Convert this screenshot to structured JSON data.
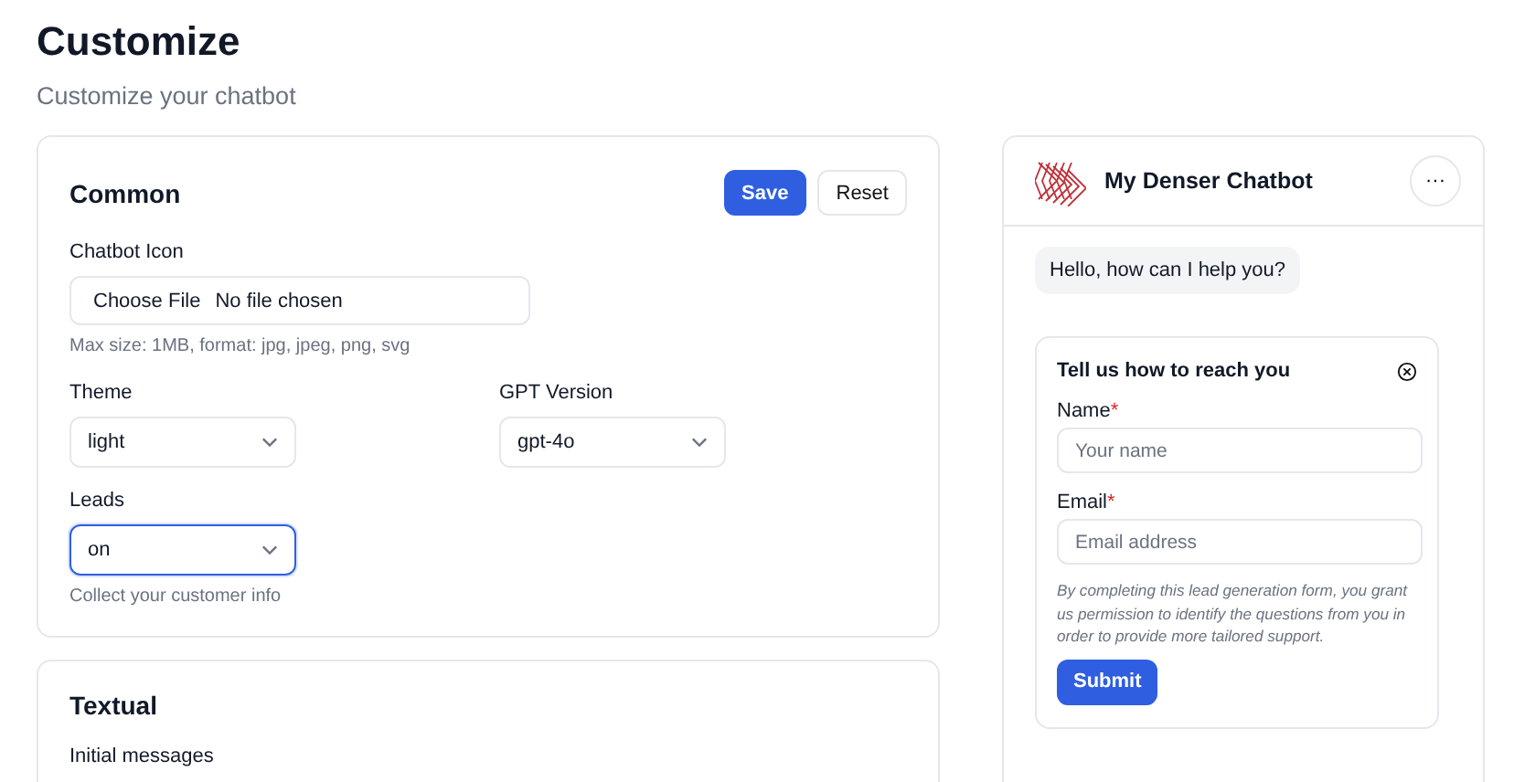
{
  "page": {
    "title": "Customize",
    "subtitle": "Customize your chatbot"
  },
  "common": {
    "title": "Common",
    "buttons": [
      {
        "label": "Save",
        "kind": "primary"
      },
      {
        "label": "Reset",
        "kind": "secondary"
      }
    ],
    "icon_field": {
      "label": "Chatbot Icon",
      "button": "Choose File",
      "value": "No file chosen",
      "hint": "Max size: 1MB, format: jpg, jpeg, png, svg"
    },
    "selects": [
      {
        "label": "Theme",
        "value": "light",
        "focused": false
      },
      {
        "label": "GPT Version",
        "value": "gpt-4o",
        "focused": false
      },
      {
        "label": "Leads",
        "value": "on",
        "focused": true,
        "hint": "Collect your customer info"
      }
    ]
  },
  "textual": {
    "title": "Textual",
    "label": "Initial messages"
  },
  "preview": {
    "title": "My Denser Chatbot",
    "menu": "···",
    "message": "Hello, how can I help you?",
    "lead_form": {
      "title": "Tell us how to reach you",
      "fields": [
        {
          "label": "Name",
          "required_mark": "*",
          "placeholder": "Your name"
        },
        {
          "label": "Email",
          "required_mark": "*",
          "placeholder": "Email address"
        }
      ],
      "note": "By completing this lead generation form, you grant us permission to identify the questions from you in order to provide more tailored support.",
      "submit": "Submit"
    }
  }
}
